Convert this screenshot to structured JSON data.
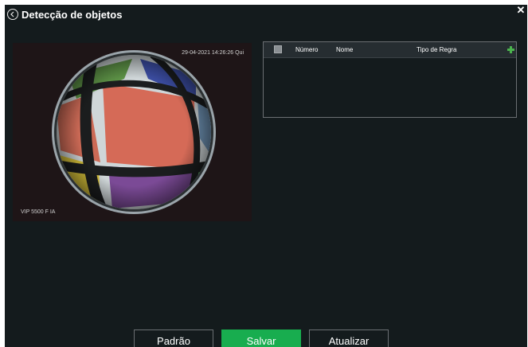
{
  "header": {
    "title": "Detecção de objetos",
    "back_icon": "chevron-left-circle-icon",
    "close_icon": "close-icon",
    "close_label": "✕"
  },
  "video": {
    "timestamp": "29-04-2021 14:26:26 Qui",
    "camera_name": "VIP 5500 F IA"
  },
  "rules_table": {
    "columns": [
      "Número",
      "Nome",
      "Tipo de Regra"
    ],
    "rows": [],
    "add_icon": "plus-icon"
  },
  "footer": {
    "default_label": "Padrão",
    "save_label": "Salvar",
    "refresh_label": "Atualizar"
  },
  "colors": {
    "background": "#141b1d",
    "header_bg": "#262d31",
    "accent": "#18ad4f",
    "add_icon": "#4bb34e"
  }
}
